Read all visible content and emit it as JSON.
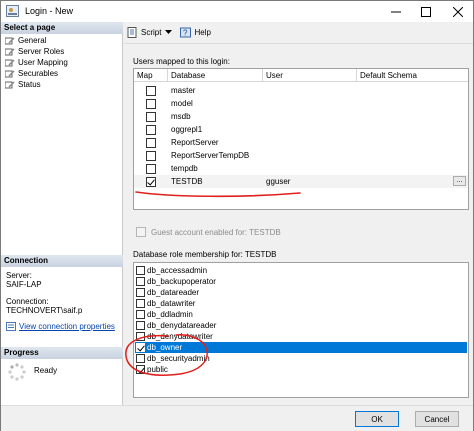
{
  "window": {
    "title": "Login - New"
  },
  "left": {
    "select_page_header": "Select a page",
    "pages": [
      "General",
      "Server Roles",
      "User Mapping",
      "Securables",
      "Status"
    ],
    "connection_header": "Connection",
    "server_label": "Server:",
    "server_value": "SAIF-LAP",
    "connection_label": "Connection:",
    "connection_value": "TECHNOVERT\\saif.p",
    "view_connection": "View connection properties",
    "progress_header": "Progress",
    "progress_status": "Ready"
  },
  "toolbar": {
    "script_label": "Script",
    "help_label": "Help"
  },
  "mapping": {
    "label": "Users mapped to this login:",
    "columns": [
      "Map",
      "Database",
      "User",
      "Default Schema"
    ],
    "rows": [
      {
        "db": "master",
        "user": "",
        "checked": false
      },
      {
        "db": "model",
        "user": "",
        "checked": false
      },
      {
        "db": "msdb",
        "user": "",
        "checked": false
      },
      {
        "db": "oggrepl1",
        "user": "",
        "checked": false
      },
      {
        "db": "ReportServer",
        "user": "",
        "checked": false
      },
      {
        "db": "ReportServerTempDB",
        "user": "",
        "checked": false
      },
      {
        "db": "tempdb",
        "user": "",
        "checked": false
      },
      {
        "db": "TESTDB",
        "user": "gguser",
        "checked": true
      }
    ],
    "ellipsis": "..."
  },
  "guest": {
    "label": "Guest account enabled for: TESTDB"
  },
  "roles": {
    "label": "Database role membership for: TESTDB",
    "items": [
      {
        "name": "db_accessadmin",
        "checked": false
      },
      {
        "name": "db_backupoperator",
        "checked": false
      },
      {
        "name": "db_datareader",
        "checked": false
      },
      {
        "name": "db_datawriter",
        "checked": false
      },
      {
        "name": "db_ddladmin",
        "checked": false
      },
      {
        "name": "db_denydatareader",
        "checked": false
      },
      {
        "name": "db_denydatawriter",
        "checked": false
      },
      {
        "name": "db_owner",
        "checked": true,
        "selected": true
      },
      {
        "name": "db_securityadmin",
        "checked": false
      },
      {
        "name": "public",
        "checked": true
      }
    ]
  },
  "footer": {
    "ok_label": "OK",
    "cancel_label": "Cancel"
  },
  "colors": {
    "selection": "#0078d7",
    "annotation": "#e0201c",
    "link": "#0645ad"
  }
}
